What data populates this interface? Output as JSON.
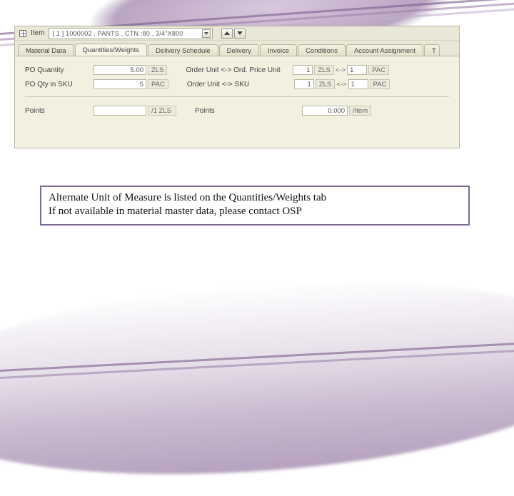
{
  "item_header": {
    "label": "Item",
    "dropdown_value": "[ 1 ] 1000002 , PANTS , CTN :80 , 3/4\"X800"
  },
  "tabs": [
    {
      "label": "Material Data"
    },
    {
      "label": "Quantities/Weights"
    },
    {
      "label": "Delivery Schedule"
    },
    {
      "label": "Delivery"
    },
    {
      "label": "Invoice"
    },
    {
      "label": "Conditions"
    },
    {
      "label": "Account Assignment"
    },
    {
      "label": "T"
    }
  ],
  "active_tab_index": 1,
  "fields": {
    "po_quantity_label": "PO Quantity",
    "po_quantity_value": "5.00",
    "po_quantity_unit": "ZLS",
    "order_unit_priceunit_label": "Order Unit <-> Ord. Price Unit",
    "oupu_left": "1",
    "oupu_left_unit": "ZLS",
    "oupu_arrow": "<->",
    "oupu_right": "1",
    "oupu_right_unit": "PAC",
    "po_qty_in_sku_label": "PO Qty in SKU",
    "po_qty_in_sku_value": "5",
    "po_qty_in_sku_unit": "PAC",
    "order_unit_sku_label": "Order Unit <-> SKU",
    "ousku_left": "1",
    "ousku_left_unit": "ZLS",
    "ousku_arrow": "<->",
    "ousku_right": "1",
    "ousku_right_unit": "PAC",
    "points_left_label": "Points",
    "points_left_value": "",
    "points_left_unit": "/1 ZLS",
    "points_right_label": "Points",
    "points_right_value": "0.000",
    "points_right_unit": "/Item"
  },
  "callout": {
    "line1": "Alternate Unit of Measure is listed on the Quantities/Weights tab",
    "line2": "If not available in material master data, please contact OSP"
  }
}
